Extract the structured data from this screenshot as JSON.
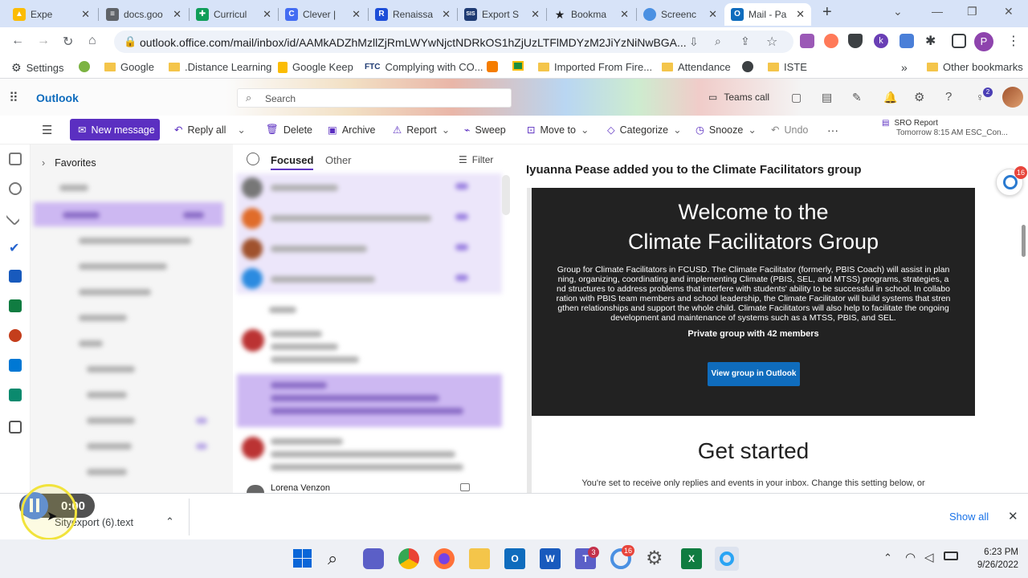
{
  "browser": {
    "tabs": [
      {
        "title": "Expe",
        "color": "#34a853",
        "icon": "google-drive-icon"
      },
      {
        "title": "docs.goo",
        "color": "#5f6368",
        "icon": "docs-icon"
      },
      {
        "title": "Curricul",
        "color": "#0f9d58",
        "icon": "sheets-icon"
      },
      {
        "title": "Clever |",
        "color": "#436cf2",
        "icon": "clever-icon"
      },
      {
        "title": "Renaissa",
        "color": "#1d4ed8",
        "icon": "renaissance-icon"
      },
      {
        "title": "Export S",
        "color": "#1f3b73",
        "icon": "sis-icon"
      },
      {
        "title": "Bookma",
        "color": "#202124",
        "icon": "star-icon"
      },
      {
        "title": "Screenc",
        "color": "#4a90e2",
        "icon": "screencast-icon"
      },
      {
        "title": "Mail - Pa",
        "color": "#0f6cbd",
        "icon": "outlook-icon"
      }
    ],
    "new_tab": "+",
    "url": "outlook.office.com/mail/inbox/id/AAMkADZhMzllZjRmLWYwNjctNDRkOS1hZjUzLTFlMDYzM2JiYzNiNwBGA...",
    "bookmarks": [
      {
        "label": "Settings",
        "icon": "gear-icon"
      },
      {
        "label": "",
        "icon": "extension-icon"
      },
      {
        "label": "Google",
        "icon": "folder-icon"
      },
      {
        "label": ".Distance Learning",
        "icon": "folder-icon"
      },
      {
        "label": "Google Keep",
        "icon": "keep-icon"
      },
      {
        "label": "Complying with CO...",
        "icon": "ftc-icon"
      },
      {
        "label": "",
        "icon": "blogger-icon"
      },
      {
        "label": "",
        "icon": "classroom-icon"
      },
      {
        "label": "Imported From Fire...",
        "icon": "folder-icon"
      },
      {
        "label": "Attendance",
        "icon": "folder-icon"
      },
      {
        "label": "",
        "icon": "globe-icon"
      },
      {
        "label": "ISTE",
        "icon": "folder-icon"
      }
    ],
    "more": "»",
    "other_bookmarks": "Other bookmarks"
  },
  "outlook": {
    "app_name": "Outlook",
    "search_placeholder": "Search",
    "teams_call": "Teams call",
    "notification_count": "2",
    "commands": {
      "new_message": "New message",
      "reply_all": "Reply all",
      "delete": "Delete",
      "archive": "Archive",
      "report": "Report",
      "sweep": "Sweep",
      "move_to": "Move to",
      "categorize": "Categorize",
      "snooze": "Snooze",
      "undo": "Undo",
      "more": "···"
    },
    "reminder": {
      "title": "SRO Report",
      "time": "Tomorrow 8:15 AM ESC_Con..."
    },
    "folders": {
      "favorites": "Favorites"
    },
    "list": {
      "focused": "Focused",
      "other": "Other",
      "filter": "Filter",
      "last_sender": "Lorena Venzon"
    },
    "email": {
      "subject": "Iyuanna Pease added you to the Climate Facilitators group",
      "welcome_line1": "Welcome to the",
      "welcome_line2": "Climate Facilitators Group",
      "description": "Group for Climate Facilitators in FCUSD. The Climate Facilitator (formerly, PBIS Coach) will assist in planning, organizing, coordinating and implementing Climate (PBIS, SEL, and MTSS) programs, strategies, and structures to address problems that interfere with students' ability to be successful in school. In collaboration with PBIS team members and school leadership, the Climate Facilitator will build systems that strengthen relationships and support the whole child. Climate Facilitators will also help to facilitate the ongoing development and maintenance of systems such as a MTSS, PBIS, and SEL.",
      "privacy": "Private group with 42 members",
      "view_button": "View group in Outlook",
      "get_started": "Get started",
      "settings_note": "You're set to receive only replies and events in your inbox. Change this setting below, or"
    },
    "copilot_badge": "16"
  },
  "recording": {
    "time": "0:00"
  },
  "download": {
    "filename": "Sityexport (6).text",
    "show_all": "Show all"
  },
  "taskbar": {
    "apps": [
      {
        "name": "start-icon",
        "color": "#0a66d8"
      },
      {
        "name": "search-icon",
        "color": "#333"
      },
      {
        "name": "chat-icon",
        "color": "#5b5fc7"
      },
      {
        "name": "chrome-icon",
        "color": "#ea4335"
      },
      {
        "name": "firefox-icon",
        "color": "#ff7139"
      },
      {
        "name": "explorer-icon",
        "color": "#f4c54a"
      },
      {
        "name": "outlook-icon",
        "color": "#0f6cbd"
      },
      {
        "name": "word-icon",
        "color": "#185abd"
      },
      {
        "name": "teams-icon",
        "color": "#5b5fc7"
      },
      {
        "name": "screencast-icon",
        "color": "#4a90e2"
      },
      {
        "name": "settings-icon",
        "color": "#666"
      },
      {
        "name": "excel-icon",
        "color": "#107c41"
      },
      {
        "name": "recorder-icon",
        "color": "#2aa4f4"
      }
    ],
    "teams_badge": "3",
    "screencast_badge": "16",
    "time": "6:23 PM",
    "date": "9/26/2022"
  },
  "colors": {
    "accent": "#0f6cbd",
    "new_message": "#5b2fc1",
    "selection": "#d9ccf7"
  }
}
